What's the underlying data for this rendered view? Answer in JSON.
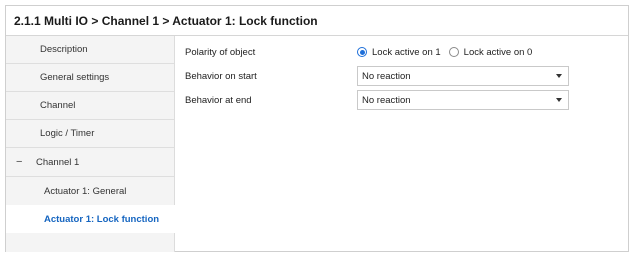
{
  "title": "2.1.1 Multi IO > Channel 1 > Actuator 1: Lock function",
  "sidebar": {
    "items": [
      {
        "label": "Description"
      },
      {
        "label": "General settings"
      },
      {
        "label": "Channel"
      },
      {
        "label": "Logic / Timer"
      }
    ],
    "group": {
      "label": "Channel 1",
      "expanded_symbol": "−"
    },
    "subitems": [
      {
        "label": "Actuator 1: General"
      },
      {
        "label": "Actuator 1: Lock function",
        "active": true
      }
    ]
  },
  "form": {
    "polarity": {
      "label": "Polarity of object",
      "options": [
        "Lock active on 1",
        "Lock active on 0"
      ],
      "selected": "Lock active on 1"
    },
    "behavior_start": {
      "label": "Behavior on start",
      "value": "No reaction"
    },
    "behavior_end": {
      "label": "Behavior at end",
      "value": "No reaction"
    }
  },
  "colors": {
    "accent": "#1e6fd9",
    "active_text": "#1565c0"
  }
}
